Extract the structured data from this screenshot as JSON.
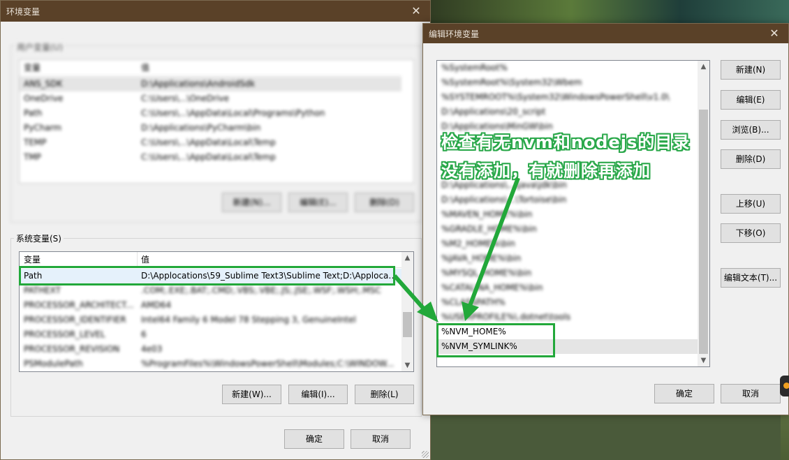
{
  "env_dialog": {
    "title": "环境变量",
    "user_group_label": "blur:用户变量",
    "user_vars": {
      "headers": [
        "变量",
        "值"
      ],
      "rows": [
        [
          "ANS_SDK",
          "D:\\Applications\\AndroidSdk"
        ],
        [
          "OneDrive",
          "C:\\Users\\...\\OneDrive"
        ],
        [
          "Path",
          "C:\\Users\\...\\AppData\\Local\\Programs\\Python"
        ],
        [
          "PyCharm",
          "D:\\Applications\\PyCharm\\bin"
        ],
        [
          "TEMP",
          "C:\\Users\\...\\AppData\\Local\\Temp"
        ],
        [
          "TMP",
          "C:\\Users\\...\\AppData\\Local\\Temp"
        ]
      ],
      "buttons": [
        "新建(N)...",
        "编辑(E)...",
        "删除(D)"
      ]
    },
    "system_group_label": "系统变量(S)",
    "system_vars": {
      "headers": [
        "变量",
        "值"
      ],
      "rows": [
        [
          "Path",
          "D:\\Applocations\\59_Sublime Text3\\Sublime Text;D:\\Applocati..."
        ],
        [
          "PATHEXT",
          ".COM;.EXE;.BAT;.CMD;.VBS;.VBE;.JS;.JSE;.WSF;.WSH;.MSC"
        ],
        [
          "PROCESSOR_ARCHITECT...",
          "AMD64"
        ],
        [
          "PROCESSOR_IDENTIFIER",
          "Intel64 Family 6 Model 78 Stepping 3, GenuineIntel"
        ],
        [
          "PROCESSOR_LEVEL",
          "6"
        ],
        [
          "PROCESSOR_REVISION",
          "4e03"
        ],
        [
          "PSModulePath",
          "%ProgramFiles%\\WindowsPowerShell\\Modules;C:\\WINDOW..."
        ]
      ],
      "buttons": [
        "新建(W)...",
        "编辑(I)...",
        "删除(L)"
      ]
    },
    "ok_label": "确定",
    "cancel_label": "取消"
  },
  "edit_dialog": {
    "title": "编辑环境变量",
    "entries": [
      "%SystemRoot%",
      "%SystemRoot%\\System32\\Wbem",
      "%SYSTEMROOT%\\System32\\WindowsPowerShell\\v1.0\\",
      "D:\\Applications\\20_script",
      "D:\\Applications\\MinGW\\bin",
      "",
      "",
      "",
      "D:\\Applications\\...\\java\\jdk\\bin",
      "D:\\Applications\\...\\Tortoise\\bin",
      "%MAVEN_HOME%\\bin",
      "%GRADLE_HOME%\\bin",
      "%M2_HOME%\\bin",
      "%JAVA_HOME%\\bin",
      "%MYSQL_HOME%\\bin",
      "%CATALINA_HOME%\\bin",
      "%CLASSPATH%",
      "%USERPROFILE%\\.dotnet\\tools",
      "%NVM_HOME%",
      "%NVM_SYMLINK%"
    ],
    "buttons": {
      "new": "新建(N)",
      "edit": "编辑(E)",
      "browse": "浏览(B)...",
      "delete": "删除(D)",
      "up": "上移(U)",
      "down": "下移(O)",
      "edit_text": "编辑文本(T)..."
    },
    "ok_label": "确定",
    "cancel_label": "取消"
  },
  "annotation": {
    "line1": "检查有无nvm和nodejs的目录",
    "line2": "没有添加，有就删除再添加",
    "color": "#22a83a"
  }
}
